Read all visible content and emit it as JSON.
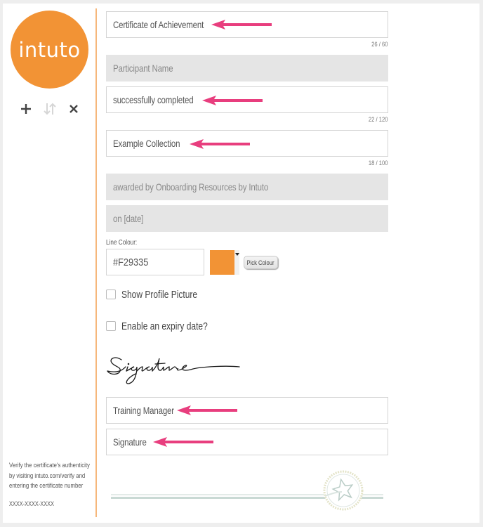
{
  "sidebar": {
    "logo_text": "intuto",
    "icons": {
      "add": "plus-icon",
      "reorder": "sort-arrows-icon",
      "remove": "close-icon"
    },
    "verify_text_lines": [
      "Verify the certificate's authenticity",
      "by visiting intuto.com/verify and",
      "entering the certificate number"
    ],
    "certificate_number": "XXXX-XXXX-XXXX"
  },
  "form": {
    "title_field": {
      "value": "Certificate of Achievement",
      "counter": "26 / 60"
    },
    "participant_field": {
      "value": "Participant Name"
    },
    "completed_field": {
      "value": "successfully completed",
      "counter": "22 / 120"
    },
    "collection_field": {
      "value": "Example Collection",
      "counter": "18 / 100"
    },
    "awarded_field": {
      "value": "awarded by Onboarding Resources by Intuto"
    },
    "date_field": {
      "value": "on [date]"
    },
    "line_colour": {
      "label": "Line Colour:",
      "value": "#F29335",
      "swatch_color": "#F29335",
      "pick_button": "Pick Colour"
    },
    "show_profile_picture": {
      "label": "Show Profile Picture",
      "checked": false
    },
    "enable_expiry": {
      "label": "Enable an expiry date?",
      "checked": false
    },
    "signature_image_alt": "Signature",
    "signer_title_field": {
      "value": "Training Manager"
    },
    "signature_field": {
      "value": "Signature"
    }
  },
  "colors": {
    "accent": "#F29335",
    "annotation_arrow": "#E83E7E",
    "readonly_field_bg": "#E5E5E5"
  }
}
